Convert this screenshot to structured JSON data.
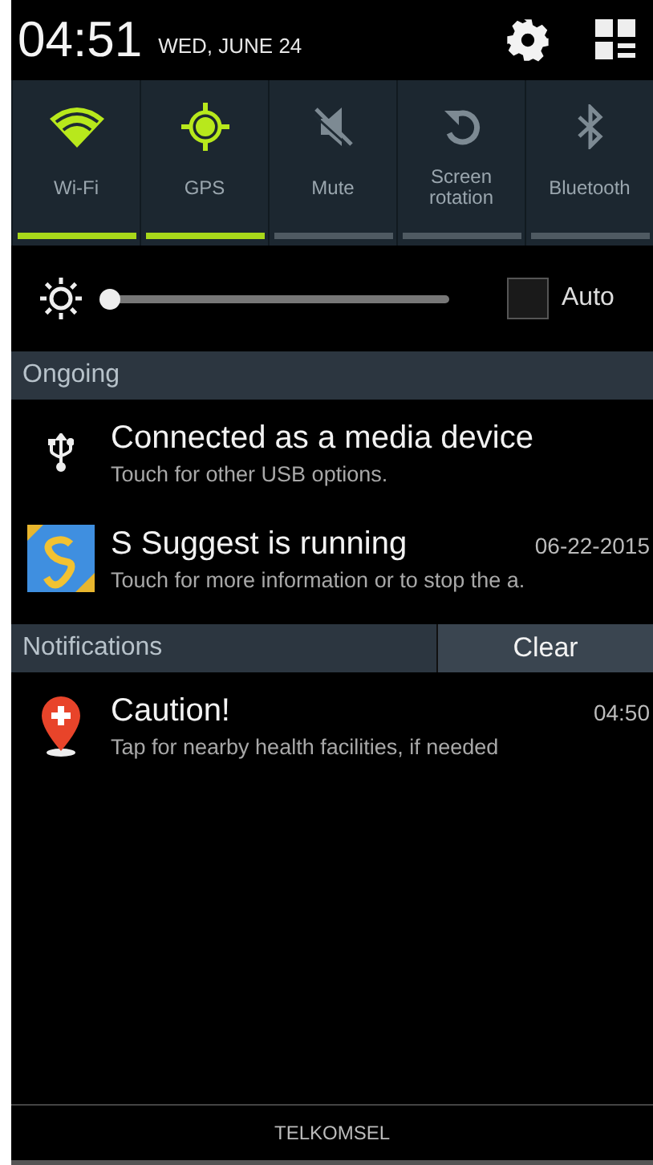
{
  "status_bar": {
    "time": "04:51",
    "date": "WED, JUNE 24"
  },
  "toggles": [
    {
      "label": "Wi-Fi",
      "on": true
    },
    {
      "label": "GPS",
      "on": true
    },
    {
      "label": "Mute",
      "on": false
    },
    {
      "label": "Screen rotation",
      "on": false
    },
    {
      "label": "Bluetooth",
      "on": false
    }
  ],
  "brightness": {
    "level": 0.02,
    "auto_label": "Auto",
    "auto_checked": false
  },
  "ongoing": {
    "title": "Ongoing",
    "items": [
      {
        "title": "Connected as a media device",
        "text": "Touch for other USB options."
      },
      {
        "title": "S Suggest is running",
        "time": "06-22-2015",
        "text": "Touch for more information or to stop the a."
      }
    ]
  },
  "notifications": {
    "title": "Notifications",
    "clear_label": "Clear",
    "items": [
      {
        "title": "Caution!",
        "time": "04:50",
        "text": "Tap for nearby health facilities, if needed"
      }
    ]
  },
  "carrier": "TELKOMSEL"
}
